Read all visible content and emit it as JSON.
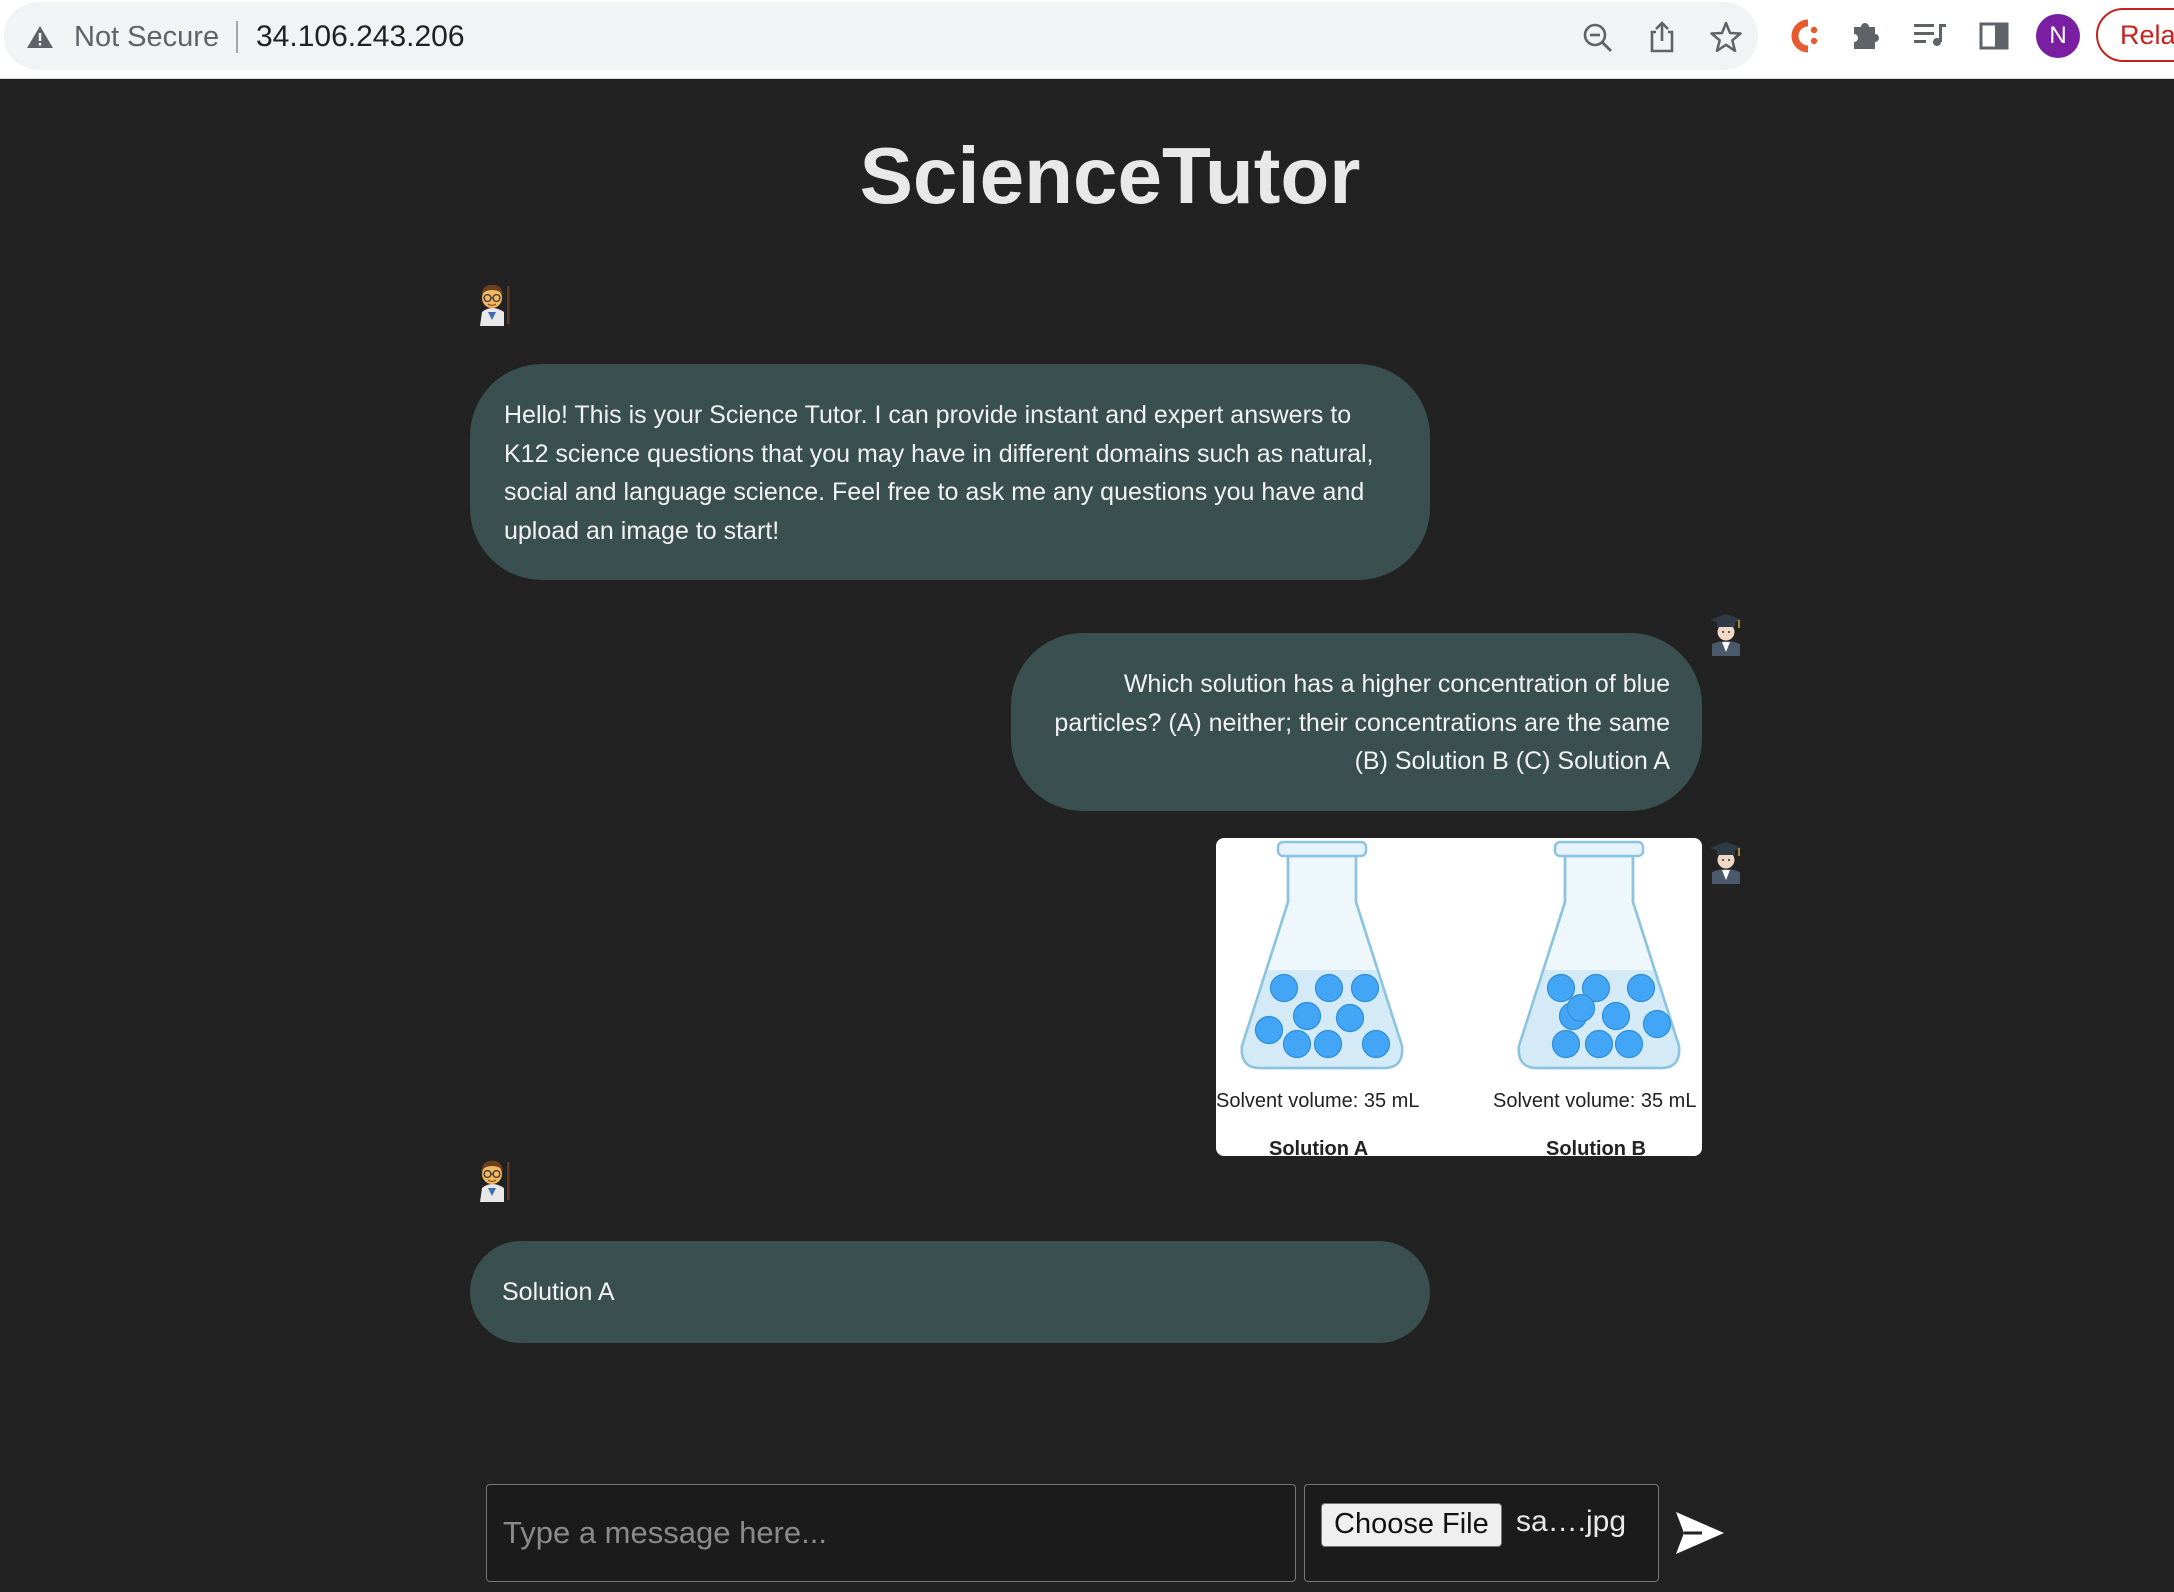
{
  "browser": {
    "security_label": "Not Secure",
    "url": "34.106.243.206",
    "profile_initial": "N",
    "relaunch_label": "Rela",
    "icons": [
      "warning-icon",
      "zoom-out-icon",
      "share-icon",
      "bookmark-star-icon",
      "extension-c-icon",
      "extensions-puzzle-icon",
      "media-queue-icon",
      "side-panel-icon"
    ]
  },
  "page": {
    "title": "ScienceTutor"
  },
  "chat": {
    "messages": [
      {
        "role": "bot",
        "text": "Hello! This is your Science Tutor. I can provide instant and expert answers to K12 science questions that you may have in different domains such as natural, social and language science. Feel free to ask me any questions you have and upload an image to start!"
      },
      {
        "role": "user",
        "text": "Which solution has a higher concentration of blue particles? (A) neither; their concentrations are the same (B) Solution B (C) Solution A"
      },
      {
        "role": "user",
        "image": {
          "flasks": [
            {
              "volume_label": "Solvent volume: 35 mL",
              "name": "Solution A",
              "particles": 9
            },
            {
              "volume_label": "Solvent volume: 35 mL",
              "name": "Solution B",
              "particles": 10
            }
          ]
        }
      },
      {
        "role": "bot",
        "text": "Solution A"
      }
    ],
    "avatars": {
      "bot": "teacher-avatar-icon",
      "user": "student-graduate-avatar-icon"
    }
  },
  "composer": {
    "placeholder": "Type a message here...",
    "choose_file_label": "Choose File",
    "file_name": "sa….jpg",
    "send_icon": "send-arrow-icon"
  },
  "colors": {
    "background": "#222222",
    "bubble": "#3a4f50",
    "particle": "#42a5f5",
    "liquid": "#d4eaf7",
    "relaunch": "#c5221f",
    "profile": "#7b1fa2"
  }
}
